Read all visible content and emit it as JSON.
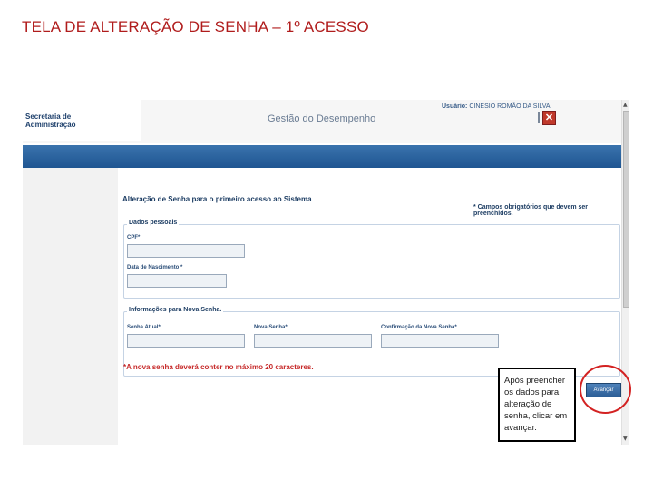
{
  "slide": {
    "title": "TELA DE ALTERAÇÃO DE SENHA – 1º ACESSO"
  },
  "header": {
    "logo_line1": "Secretaria de",
    "logo_line2": "Administração",
    "app_title": "Gestão do Desempenho",
    "user_label": "Usuário:",
    "user_name": "CINESIO ROMÃO DA SILVA",
    "close_glyph": "✕"
  },
  "form": {
    "heading": "Alteração de Senha para o primeiro acesso ao Sistema",
    "required_note": "* Campos obrigatórios que devem ser preenchidos.",
    "personal": {
      "legend": "Dados pessoais",
      "cpf_label": "CPF*",
      "cpf_value": "",
      "birth_label": "Data de Nascimento *",
      "birth_value": ""
    },
    "password": {
      "legend": "Informações para Nova Senha.",
      "current_label": "Senha Atual*",
      "current_value": "",
      "new_label": "Nova Senha*",
      "new_value": "",
      "confirm_label": "Confirmação da Nova Senha*",
      "confirm_value": ""
    },
    "warning": "*A nova senha deverá conter no máximo 20 caracteres.",
    "submit_label": "Avançar"
  },
  "callout": {
    "text": "Após preencher os dados para alteração de senha, clicar em avançar."
  },
  "icons": {
    "scroll_up": "▲",
    "scroll_down": "▼"
  },
  "colors": {
    "slide_title": "#b01c1c",
    "nav_bar": "#2a629c",
    "highlight_circle": "#d32222",
    "warning_text": "#c62828"
  }
}
